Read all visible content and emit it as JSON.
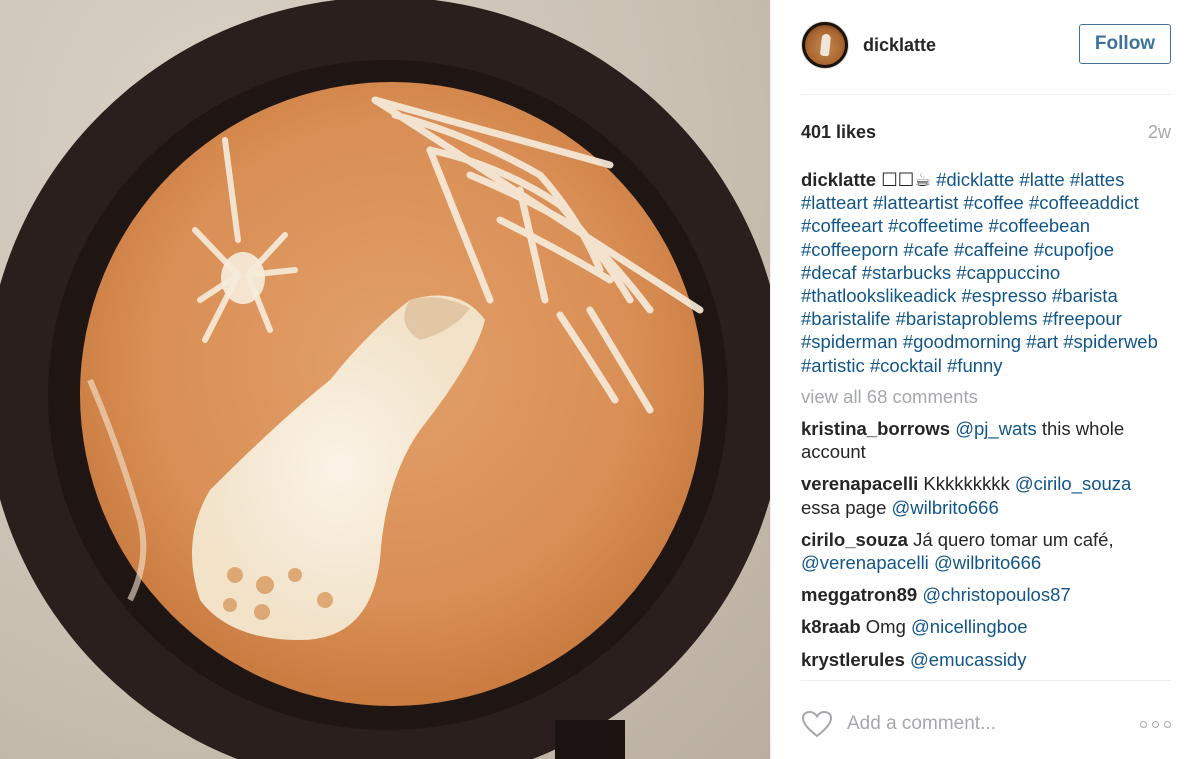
{
  "post": {
    "username": "dicklatte",
    "follow_label": "Follow",
    "likes": "401 likes",
    "age": "2w",
    "caption_emoji": "☐☐☕",
    "hashtags": [
      "#dicklatte",
      "#latte",
      "#lattes",
      "#latteart",
      "#latteartist",
      "#coffee",
      "#coffeeaddict",
      "#coffeeart",
      "#coffeetime",
      "#coffeebean",
      "#coffeeporn",
      "#cafe",
      "#caffeine",
      "#cupofjoe",
      "#decaf",
      "#starbucks",
      "#cappuccino",
      "#thatlookslikeadick",
      "#espresso",
      "#barista",
      "#baristalife",
      "#baristaproblems",
      "#freepour",
      "#spiderman",
      "#goodmorning",
      "#art",
      "#spiderweb",
      "#artistic",
      "#cocktail",
      "#funny"
    ],
    "view_all": "view all 68 comments"
  },
  "comments": [
    {
      "user": "kristina_borrows",
      "mention": "@pj_wats",
      "text": "this whole account",
      "mention2": ""
    },
    {
      "user": "verenapacelli",
      "text_before": "Kkkkkkkkk",
      "mention": "@cirilo_souza",
      "text": "essa page",
      "mention2": "@wilbrito666"
    },
    {
      "user": "cirilo_souza",
      "text_before": "Já quero tomar um café,",
      "mention": "@verenapacelli",
      "mention2": "@wilbrito666"
    },
    {
      "user": "meggatron89",
      "mention": "@christopoulos87"
    },
    {
      "user": "k8raab",
      "text_before": "Omg",
      "mention": "@nicellingboe"
    },
    {
      "user": "krystlerules",
      "mention": "@emucassidy"
    }
  ],
  "composer": {
    "placeholder": "Add a comment..."
  },
  "icons": {
    "like": "heart-icon",
    "more": "more-options-icon",
    "avatar": "profile-avatar"
  },
  "colors": {
    "hashtag": "#125688",
    "follow": "#3f729b",
    "muted": "#a5a7aa"
  }
}
